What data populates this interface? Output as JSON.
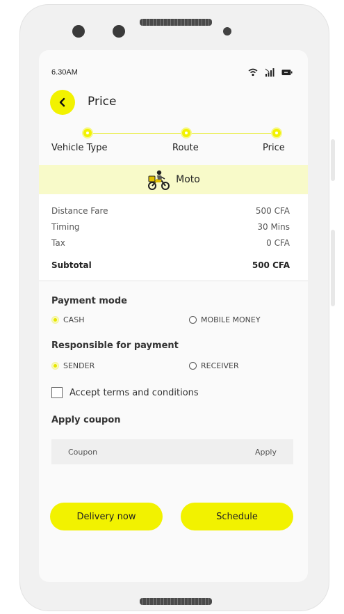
{
  "status_bar": {
    "time": "6.30AM"
  },
  "header": {
    "title": "Price",
    "back_icon": "chevron-left-icon"
  },
  "stepper": {
    "steps": [
      {
        "label": "Vehicle Type"
      },
      {
        "label": "Route"
      },
      {
        "label": "Price"
      }
    ]
  },
  "vehicle": {
    "name": "Moto",
    "icon": "motorbike-courier-icon"
  },
  "fare": {
    "rows": [
      {
        "label": "Distance Fare",
        "value": "500 CFA"
      },
      {
        "label": "Timing",
        "value": "30 Mins"
      },
      {
        "label": "Tax",
        "value": "0 CFA"
      }
    ],
    "subtotal": {
      "label": "Subtotal",
      "value": "500 CFA"
    }
  },
  "payment_mode": {
    "title": "Payment mode",
    "options": [
      {
        "label": "CASH",
        "selected": true
      },
      {
        "label": "MOBILE MONEY",
        "selected": false
      }
    ]
  },
  "responsible": {
    "title": "Responsible for payment",
    "options": [
      {
        "label": "SENDER",
        "selected": true
      },
      {
        "label": "RECEIVER",
        "selected": false
      }
    ]
  },
  "terms": {
    "label": "Accept terms and conditions",
    "checked": false
  },
  "coupon": {
    "title": "Apply coupon",
    "placeholder": "Coupon",
    "apply_label": "Apply"
  },
  "actions": {
    "delivery_now": "Delivery now",
    "schedule": "Schedule"
  },
  "colors": {
    "accent": "#f2f200",
    "banner": "#f8fac9"
  }
}
